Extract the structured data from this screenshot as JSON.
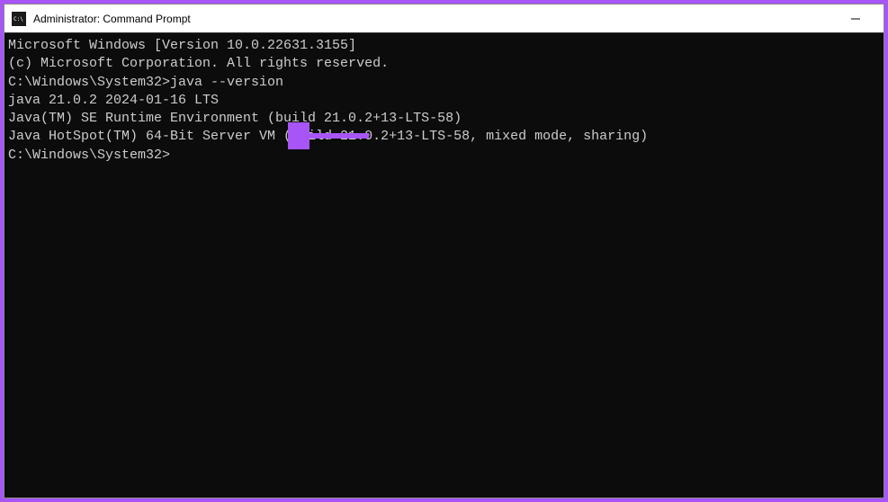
{
  "window": {
    "title": "Administrator: Command Prompt"
  },
  "terminal": {
    "lines": [
      "Microsoft Windows [Version 10.0.22631.3155]",
      "(c) Microsoft Corporation. All rights reserved.",
      "",
      "C:\\Windows\\System32>java --version",
      "java 21.0.2 2024-01-16 LTS",
      "Java(TM) SE Runtime Environment (build 21.0.2+13-LTS-58)",
      "Java HotSpot(TM) 64-Bit Server VM (build 21.0.2+13-LTS-58, mixed mode, sharing)",
      "",
      "C:\\Windows\\System32>"
    ]
  },
  "annotation": {
    "arrow_color": "#a855f7"
  }
}
